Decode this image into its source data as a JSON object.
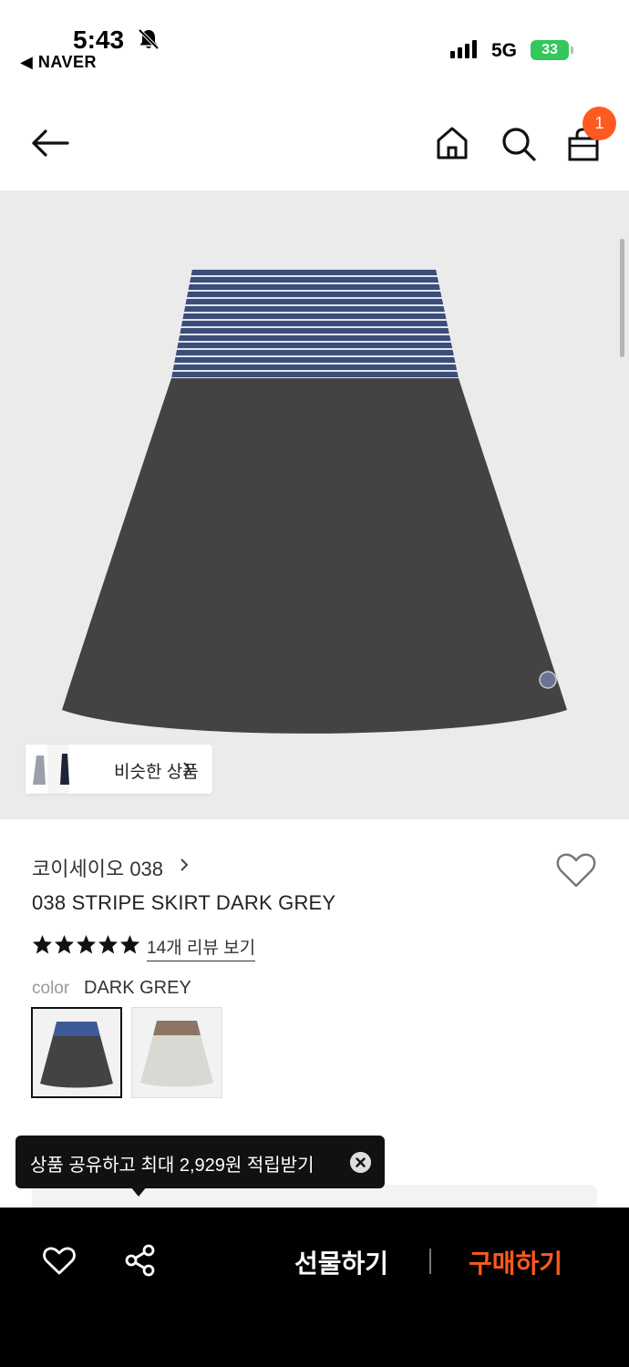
{
  "status_bar": {
    "time": "5:43",
    "back_app": "◀ NAVER",
    "network": "5G",
    "battery": "33"
  },
  "header": {
    "cart_badge": "1",
    "icons": [
      "back-arrow-icon",
      "home-icon",
      "search-icon",
      "shopping-bag-icon"
    ]
  },
  "hero": {
    "similar_label": "비슷한 상품"
  },
  "product": {
    "brand": "코이세이오 038",
    "name": "038 STRIPE SKIRT DARK GREY",
    "rating": 5,
    "review_link": "14개 리뷰 보기",
    "color_label": "color",
    "color_value": "DARK GREY"
  },
  "tooltip": {
    "text": "상품 공유하고 최대 2,929원 적립받기"
  },
  "bottom_bar": {
    "gift_label": "선물하기",
    "buy_label": "구매하기"
  },
  "colors": {
    "accent": "#ff5a1f",
    "battery": "#34c759",
    "hero_bg": "#ebebeb"
  }
}
